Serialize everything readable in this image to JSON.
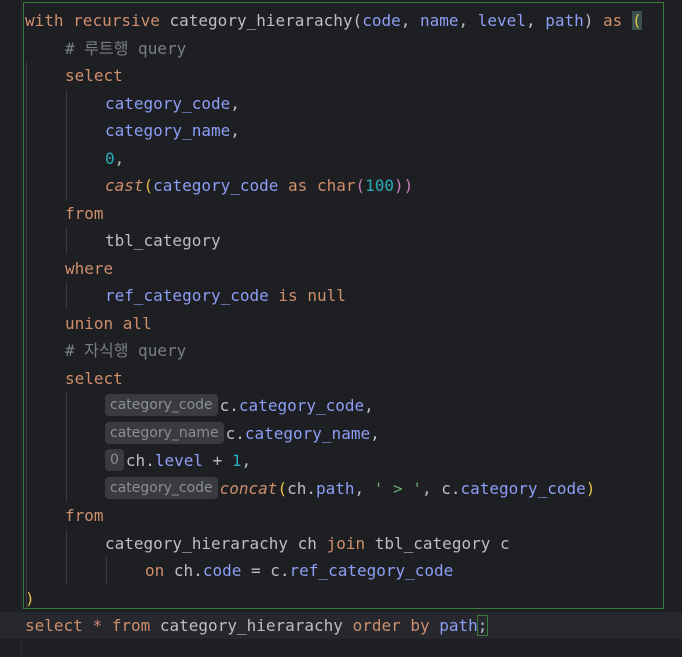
{
  "colors": {
    "background": "#1e1f22",
    "keyword": "#cf8e6d",
    "column": "#8c9ef5",
    "number": "#2aacb8",
    "string": "#6aab73",
    "comment": "#7a7e85",
    "text": "#bcbec4",
    "statement_outline": "#3c7a3c"
  },
  "code": {
    "l1": {
      "with": "with",
      "recursive": "recursive",
      "name": "category_hierarachy",
      "open": "(",
      "p1": "code",
      "c1": ", ",
      "p2": "name",
      "c2": ", ",
      "p3": "level",
      "c3": ", ",
      "p4": "path",
      "close": ")",
      "as": "as",
      "paren": "("
    },
    "l2": {
      "comment": "# 루트행 query"
    },
    "l3": {
      "select": "select"
    },
    "l4": {
      "col": "category_code",
      "comma": ","
    },
    "l5": {
      "col": "category_name",
      "comma": ","
    },
    "l6": {
      "num": "0",
      "comma": ","
    },
    "l7": {
      "fn": "cast",
      "open": "(",
      "col": "category_code",
      "as": "as",
      "type": "char",
      "open2": "(",
      "num": "100",
      "close": "))"
    },
    "l8": {
      "from": "from"
    },
    "l9": {
      "table": "tbl_category"
    },
    "l10": {
      "where": "where"
    },
    "l11": {
      "col": "ref_category_code",
      "is": "is",
      "null": "null"
    },
    "l12": {
      "union": "union all"
    },
    "l13": {
      "comment": "# 자식행 query"
    },
    "l14": {
      "select": "select"
    },
    "l15": {
      "hint": "category_code",
      "alias": "c",
      "dot": ".",
      "col": "category_code",
      "comma": ","
    },
    "l16": {
      "hint": "category_name",
      "alias": "c",
      "dot": ".",
      "col": "category_name",
      "comma": ","
    },
    "l17": {
      "hint": "0",
      "alias": "ch",
      "dot": ".",
      "col": "level",
      "plus": " + ",
      "num": "1",
      "comma": ","
    },
    "l18": {
      "hint": "category_code",
      "fn": "concat",
      "open": "(",
      "alias1": "ch",
      "dot1": ".",
      "col1": "path",
      "c1": ", ",
      "str": "' > '",
      "c2": ", ",
      "alias2": "c",
      "dot2": ".",
      "col2": "category_code",
      "close": ")"
    },
    "l19": {
      "from": "from"
    },
    "l20": {
      "table1": "category_hierarachy",
      "alias1": "ch",
      "join": "join",
      "table2": "tbl_category",
      "alias2": "c"
    },
    "l21": {
      "on": "on",
      "a1": "ch",
      "d1": ".",
      "col1": "code",
      "eq": " = ",
      "a2": "c",
      "d2": ".",
      "col2": "ref_category_code"
    },
    "l22": {
      "close": ")"
    },
    "l23": {
      "select": "select",
      "star": "*",
      "from": "from",
      "table": "category_hierarachy",
      "order": "order by",
      "col": "path",
      "semi": ";"
    }
  }
}
